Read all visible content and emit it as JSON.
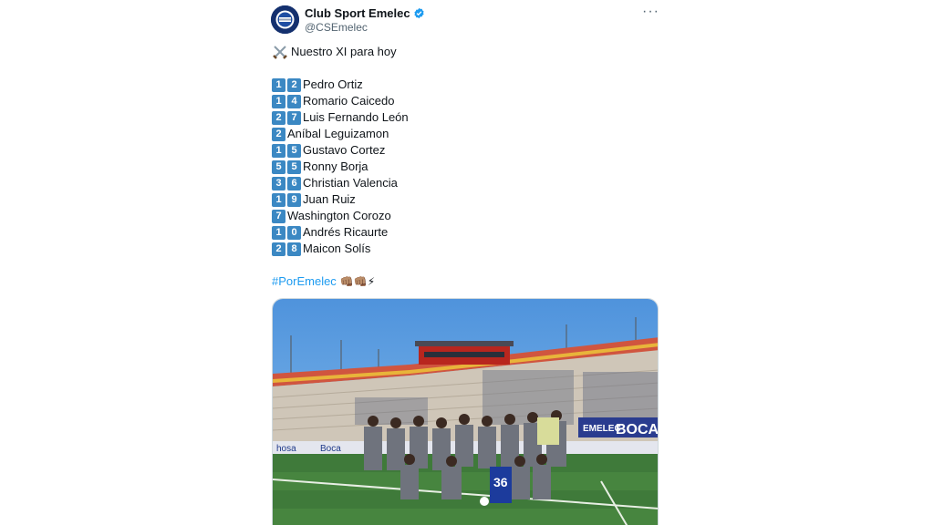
{
  "account": {
    "display_name": "Club Sport Emelec",
    "handle": "@CSEmelec",
    "avatar_icon": "emelec-crest-icon",
    "verified_icon": "verified-badge-icon",
    "more_label": "···"
  },
  "tweet": {
    "intro": "Nuestro XI para hoy",
    "intro_icon": "crossed-swords-icon",
    "lineup": [
      {
        "number": [
          "1",
          "2"
        ],
        "name": "Pedro Ortiz"
      },
      {
        "number": [
          "1",
          "4"
        ],
        "name": "Romario Caicedo"
      },
      {
        "number": [
          "2",
          "7"
        ],
        "name": "Luis Fernando León"
      },
      {
        "number": [
          "2"
        ],
        "name": "Aníbal Leguizamon"
      },
      {
        "number": [
          "1",
          "5"
        ],
        "name": "Gustavo Cortez"
      },
      {
        "number": [
          "5",
          "5"
        ],
        "name": "Ronny Borja"
      },
      {
        "number": [
          "3",
          "6"
        ],
        "name": "Christian Valencia"
      },
      {
        "number": [
          "1",
          "9"
        ],
        "name": "Juan Ruiz"
      },
      {
        "number": [
          "7"
        ],
        "name": "Washington Corozo"
      },
      {
        "number": [
          "1",
          "0"
        ],
        "name": "Andrés Ricaurte"
      },
      {
        "number": [
          "2",
          "8"
        ],
        "name": "Maicon Solís"
      }
    ],
    "hashtag": "#PorEmelec",
    "hashtag_emojis": "👊🏽👊🏽⚡",
    "photo_banner_texts": [
      "EMELEC",
      "BOCA",
      "Boca",
      "hosa"
    ],
    "photo_shirt_number": "36"
  },
  "colors": {
    "keycap": "#3b88c3",
    "link": "#1d9bf0",
    "verified": "#1d9bf0",
    "sky": "#5a9fe0",
    "grass": "#3f7a3a"
  }
}
